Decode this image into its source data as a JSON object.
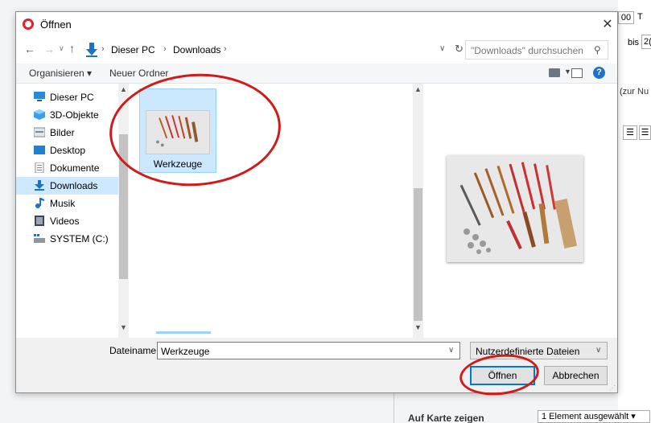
{
  "dialog": {
    "title": "Öffnen",
    "close_label": "✕"
  },
  "nav": {
    "breadcrumbs": [
      "Dieser PC",
      "Downloads"
    ],
    "search_placeholder": "\"Downloads\" durchsuchen"
  },
  "toolbar": {
    "organize_label": "Organisieren ▾",
    "new_folder_label": "Neuer Ordner"
  },
  "sidebar": {
    "items": [
      {
        "label": "Dieser PC",
        "icon": "computer-icon"
      },
      {
        "label": "3D-Objekte",
        "icon": "cube-3d-icon"
      },
      {
        "label": "Bilder",
        "icon": "pictures-icon"
      },
      {
        "label": "Desktop",
        "icon": "desktop-icon"
      },
      {
        "label": "Dokumente",
        "icon": "document-icon"
      },
      {
        "label": "Downloads",
        "icon": "download-arrow-icon",
        "selected": true
      },
      {
        "label": "Musik",
        "icon": "music-note-icon"
      },
      {
        "label": "Videos",
        "icon": "video-icon"
      },
      {
        "label": "SYSTEM (C:)",
        "icon": "drive-icon"
      }
    ]
  },
  "files": [
    {
      "name": "Werkzeuge",
      "selected": true
    }
  ],
  "bottom": {
    "filename_label": "Dateiname:",
    "filename_value": "Werkzeuge",
    "filetype_value": "Nutzerdefinierte Dateien",
    "open_label": "Öffnen",
    "cancel_label": "Abbrechen"
  },
  "background_page": {
    "btn_00": "00",
    "t_label": "T",
    "bis_label": "bis",
    "year_fragment": "2(",
    "note_fragment": "(zur Nu",
    "map_label": "Auf Karte zeigen",
    "selection_label": "1 Element ausgewählt"
  },
  "colors": {
    "accent": "#0078d7",
    "selection": "#cce8ff",
    "annotation": "#d11a1a",
    "opera_red": "#e0202a"
  }
}
